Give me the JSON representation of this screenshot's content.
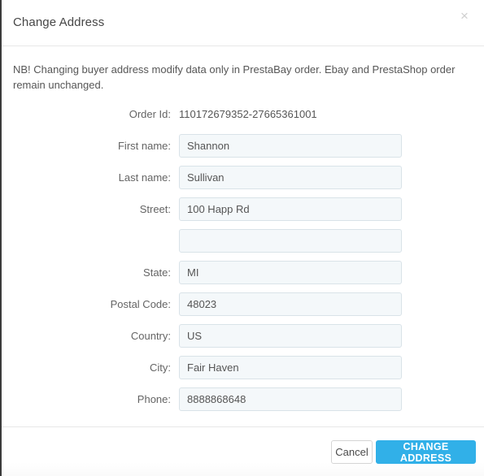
{
  "modal": {
    "title": "Change Address",
    "close_icon": "close-icon",
    "close_glyph": "×",
    "note": "NB! Changing buyer address modify data only in PrestaBay order. Ebay and PrestaShop order remain unchanged.",
    "accent_color": "#31b0e8",
    "input_bg_color": "#f4f8fa",
    "input_border_color": "#d9e3e8"
  },
  "form": {
    "rows": [
      {
        "name": "order-id",
        "label": "Order Id:",
        "type": "static",
        "value": "110172679352-27665361001",
        "placeholder": ""
      },
      {
        "name": "first-name",
        "label": "First name:",
        "type": "input",
        "value": "Shannon",
        "placeholder": ""
      },
      {
        "name": "last-name",
        "label": "Last name:",
        "type": "input",
        "value": "Sullivan",
        "placeholder": ""
      },
      {
        "name": "street",
        "label": "Street:",
        "type": "input",
        "value": "100 Happ Rd",
        "placeholder": ""
      },
      {
        "name": "street-2",
        "label": "",
        "type": "input",
        "value": "",
        "placeholder": ""
      },
      {
        "name": "state",
        "label": "State:",
        "type": "input",
        "value": "MI",
        "placeholder": ""
      },
      {
        "name": "postal-code",
        "label": "Postal Code:",
        "type": "input",
        "value": "48023",
        "placeholder": ""
      },
      {
        "name": "country",
        "label": "Country:",
        "type": "input",
        "value": "US",
        "placeholder": ""
      },
      {
        "name": "city",
        "label": "City:",
        "type": "input",
        "value": "Fair Haven",
        "placeholder": ""
      },
      {
        "name": "phone",
        "label": "Phone:",
        "type": "input",
        "value": "8888868648",
        "placeholder": ""
      }
    ]
  },
  "footer": {
    "cancel_label": "Cancel",
    "submit_label": "CHANGE ADDRESS"
  }
}
